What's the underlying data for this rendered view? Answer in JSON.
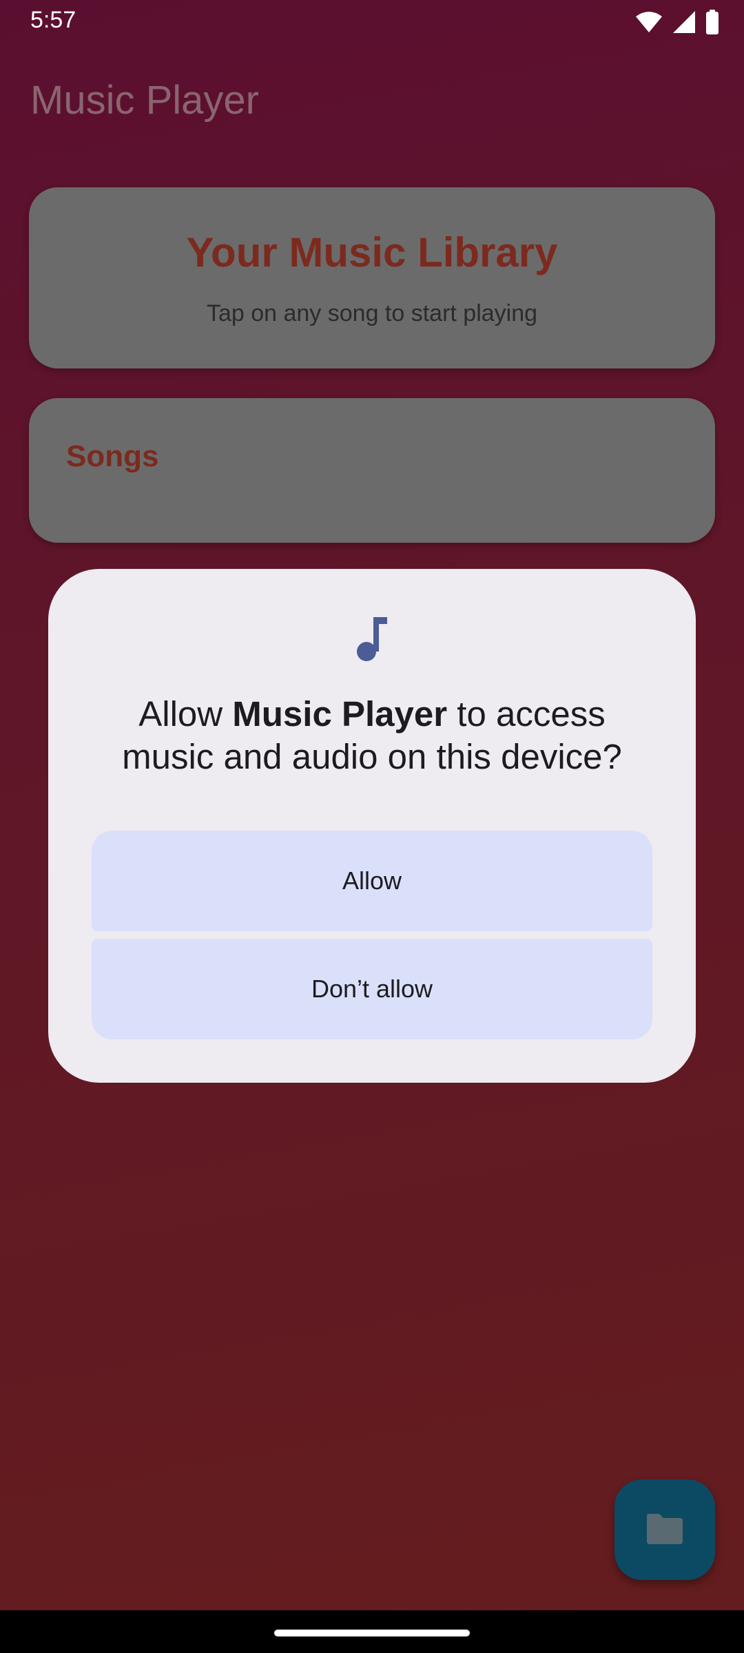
{
  "status_bar": {
    "time": "5:57",
    "icons": [
      "wifi-icon",
      "cellular-signal-icon",
      "battery-icon"
    ]
  },
  "app": {
    "title": "Music Player"
  },
  "library_card": {
    "title": "Your Music Library",
    "subtitle": "Tap on any song to start playing"
  },
  "songs_card": {
    "title": "Songs"
  },
  "permission_dialog": {
    "icon": "music-note-icon",
    "message_prefix": "Allow ",
    "app_name": "Music Player",
    "message_suffix": " to access music and audio on this device?",
    "allow_label": "Allow",
    "deny_label": "Don’t allow"
  },
  "fab": {
    "icon": "folder-icon"
  },
  "colors": {
    "accent_title": "#7c2a1e",
    "dialog_button": "#dae0fa",
    "fab": "#0b4a62",
    "icon_tint": "#4b5c96"
  }
}
